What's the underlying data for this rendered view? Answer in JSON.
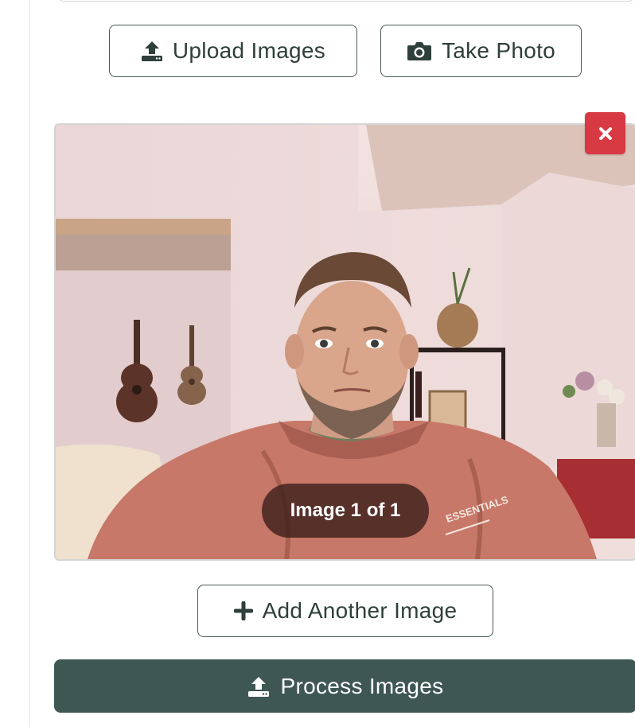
{
  "actions": {
    "upload_label": "Upload Images",
    "camera_label": "Take Photo",
    "add_label": "Add Another Image",
    "process_label": "Process Images"
  },
  "preview": {
    "counter_text": "Image 1 of 1",
    "sweatshirt_text": "ESSENTIALS",
    "remove_symbol": "×"
  },
  "icons": {
    "upload": "upload-tray-icon",
    "camera": "camera-icon",
    "add": "plus-icon",
    "remove": "close-icon",
    "process": "upload-tray-icon"
  },
  "colors": {
    "primary": "#3f5753",
    "outline": "#4a5a55",
    "danger": "#d83a44",
    "text": "#2f3f3b"
  }
}
